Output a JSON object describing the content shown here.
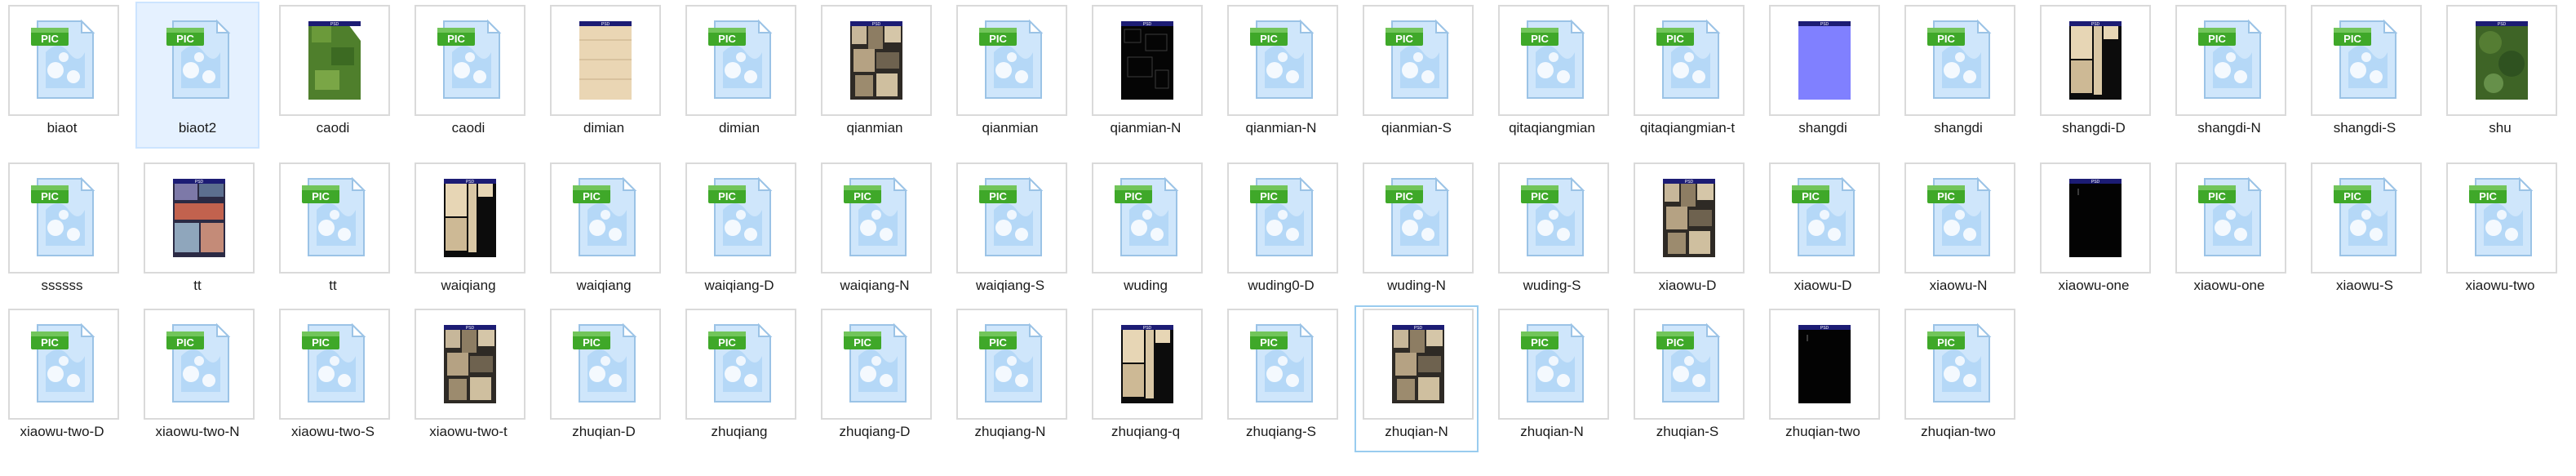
{
  "files": [
    {
      "name": "biaot",
      "type": "pic",
      "selected": false,
      "focused": false
    },
    {
      "name": "biaot2",
      "type": "pic",
      "selected": true,
      "focused": false
    },
    {
      "name": "caodi",
      "type": "psd-grass",
      "selected": false,
      "focused": false
    },
    {
      "name": "caodi",
      "type": "pic",
      "selected": false,
      "focused": false
    },
    {
      "name": "dimian",
      "type": "psd-wood",
      "selected": false,
      "focused": false
    },
    {
      "name": "dimian",
      "type": "pic",
      "selected": false,
      "focused": false
    },
    {
      "name": "qianmian",
      "type": "psd-facade",
      "selected": false,
      "focused": false
    },
    {
      "name": "qianmian",
      "type": "pic",
      "selected": false,
      "focused": false
    },
    {
      "name": "qianmian-N",
      "type": "psd-dark-lines",
      "selected": false,
      "focused": false
    },
    {
      "name": "qianmian-N",
      "type": "pic",
      "selected": false,
      "focused": false
    },
    {
      "name": "qianmian-S",
      "type": "pic",
      "selected": false,
      "focused": false
    },
    {
      "name": "qitaqiangmian",
      "type": "pic",
      "selected": false,
      "focused": false
    },
    {
      "name": "qitaqiangmian-t",
      "type": "pic",
      "selected": false,
      "focused": false
    },
    {
      "name": "shangdi",
      "type": "psd-blue",
      "selected": false,
      "focused": false
    },
    {
      "name": "shangdi",
      "type": "pic",
      "selected": false,
      "focused": false
    },
    {
      "name": "shangdi-D",
      "type": "psd-beige-black",
      "selected": false,
      "focused": false
    },
    {
      "name": "shangdi-N",
      "type": "pic",
      "selected": false,
      "focused": false
    },
    {
      "name": "shangdi-S",
      "type": "pic",
      "selected": false,
      "focused": false
    },
    {
      "name": "shu",
      "type": "psd-tree",
      "selected": false,
      "focused": false
    },
    {
      "name": "ssssss",
      "type": "pic",
      "selected": false,
      "focused": false
    },
    {
      "name": "tt",
      "type": "psd-colorful",
      "selected": false,
      "focused": false
    },
    {
      "name": "tt",
      "type": "pic",
      "selected": false,
      "focused": false
    },
    {
      "name": "waiqiang",
      "type": "psd-beige-black",
      "selected": false,
      "focused": false
    },
    {
      "name": "waiqiang",
      "type": "pic",
      "selected": false,
      "focused": false
    },
    {
      "name": "waiqiang-D",
      "type": "pic",
      "selected": false,
      "focused": false
    },
    {
      "name": "waiqiang-N",
      "type": "pic",
      "selected": false,
      "focused": false
    },
    {
      "name": "waiqiang-S",
      "type": "pic",
      "selected": false,
      "focused": false
    },
    {
      "name": "wuding",
      "type": "pic",
      "selected": false,
      "focused": false
    },
    {
      "name": "wuding0-D",
      "type": "pic",
      "selected": false,
      "focused": false
    },
    {
      "name": "wuding-N",
      "type": "pic",
      "selected": false,
      "focused": false
    },
    {
      "name": "wuding-S",
      "type": "pic",
      "selected": false,
      "focused": false
    },
    {
      "name": "xiaowu-D",
      "type": "psd-facade",
      "selected": false,
      "focused": false
    },
    {
      "name": "xiaowu-D",
      "type": "pic",
      "selected": false,
      "focused": false
    },
    {
      "name": "xiaowu-N",
      "type": "pic",
      "selected": false,
      "focused": false
    },
    {
      "name": "xiaowu-one",
      "type": "psd-black",
      "selected": false,
      "focused": false
    },
    {
      "name": "xiaowu-one",
      "type": "pic",
      "selected": false,
      "focused": false
    },
    {
      "name": "xiaowu-S",
      "type": "pic",
      "selected": false,
      "focused": false
    },
    {
      "name": "xiaowu-two",
      "type": "pic",
      "selected": false,
      "focused": false
    },
    {
      "name": "xiaowu-two-D",
      "type": "pic",
      "selected": false,
      "focused": false
    },
    {
      "name": "xiaowu-two-N",
      "type": "pic",
      "selected": false,
      "focused": false
    },
    {
      "name": "xiaowu-two-S",
      "type": "pic",
      "selected": false,
      "focused": false
    },
    {
      "name": "xiaowu-two-t",
      "type": "psd-facade",
      "selected": false,
      "focused": false
    },
    {
      "name": "zhuqian-D",
      "type": "pic",
      "selected": false,
      "focused": false
    },
    {
      "name": "zhuqiang",
      "type": "pic",
      "selected": false,
      "focused": false
    },
    {
      "name": "zhuqiang-D",
      "type": "pic",
      "selected": false,
      "focused": false
    },
    {
      "name": "zhuqiang-N",
      "type": "pic",
      "selected": false,
      "focused": false
    },
    {
      "name": "zhuqiang-q",
      "type": "psd-beige-black",
      "selected": false,
      "focused": false
    },
    {
      "name": "zhuqiang-S",
      "type": "pic",
      "selected": false,
      "focused": false
    },
    {
      "name": "zhuqian-N",
      "type": "psd-facade",
      "selected": false,
      "focused": true
    },
    {
      "name": "zhuqian-N",
      "type": "pic",
      "selected": false,
      "focused": false
    },
    {
      "name": "zhuqian-S",
      "type": "pic",
      "selected": false,
      "focused": false
    },
    {
      "name": "zhuqian-two",
      "type": "psd-black",
      "selected": false,
      "focused": false
    },
    {
      "name": "zhuqian-two",
      "type": "pic",
      "selected": false,
      "focused": false
    }
  ],
  "icon_badge": {
    "pic": "PIC",
    "psd": "PSD"
  },
  "colors": {
    "pic_tab": "#3fa829",
    "pic_sheet": "#d3eaff",
    "psd_header": "#1c1c74",
    "selected_bg": "#e5f1ff",
    "focus_border": "#99ccef"
  }
}
